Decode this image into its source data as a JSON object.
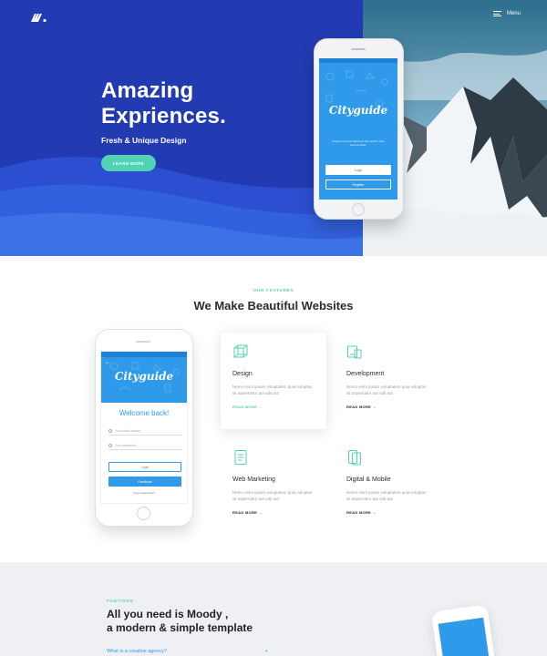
{
  "hero": {
    "menu_label": "Menu",
    "title_line1": "Amazing",
    "title_line2": "Exprіences.",
    "subtitle": "Fresh & Unique Design",
    "cta_label": "LEARN MORE",
    "phone": {
      "logo": "Cityguide",
      "tagline": "Explore the best places of the world's most famous cities",
      "login": "Login",
      "register": "Register"
    }
  },
  "features": {
    "kicker": "OUR FEATURES",
    "title": "We Make Beautiful Websites",
    "phone": {
      "logo": "Cityguide",
      "welcome": "Welcome back!",
      "email_placeholder": "Your email adress",
      "password_placeholder": "Your password",
      "login": "Login",
      "facebook": "Facebook",
      "forgot": "Forgot password?"
    },
    "cards": [
      {
        "title": "Design",
        "text": "Nemo enim ipsam voluptatem quia voluptas sit aspernatur aut odit aut",
        "link": "READ MORE →",
        "icon": "cube-icon"
      },
      {
        "title": "Development",
        "text": "Nemo enim ipsam voluptatem quia voluptas sit aspernatur aut odit aut",
        "link": "READ MORE →",
        "icon": "devices-icon"
      },
      {
        "title": "Web Marketing",
        "text": "Nemo enim ipsam voluptatem quia voluptas sit aspernatur aut odit aut",
        "link": "READ MORE →",
        "icon": "document-icon"
      },
      {
        "title": "Digital & Mobile",
        "text": "Nemo enim ipsam voluptatem quia voluptas sit aspernatur aut odit aut",
        "link": "READ MORE →",
        "icon": "mobile-icon"
      }
    ]
  },
  "bottom": {
    "kicker": "FUNTIONS",
    "title_line1": "All you need is Moody ,",
    "title_line2": "a modern & simple template",
    "question": "What is a creative agency?",
    "question_toggle": "+"
  },
  "colors": {
    "hero_blue": "#233bb2",
    "accent": "#52d3b4",
    "app_blue": "#2f9ae9"
  }
}
